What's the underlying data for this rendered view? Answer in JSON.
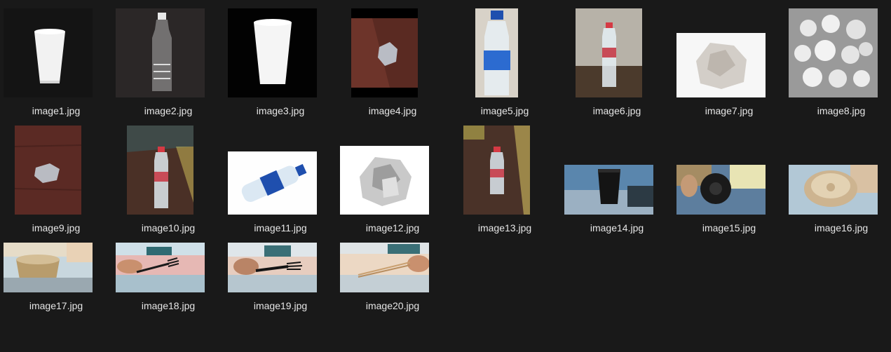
{
  "window": {
    "view": "Large icons",
    "background": "#191919",
    "label_color": "#e6e6e6"
  },
  "files": [
    {
      "name": "image1.jpg",
      "icon": "paper-cup-thumbnail"
    },
    {
      "name": "image2.jpg",
      "icon": "plastic-bottle-thumbnail"
    },
    {
      "name": "image3.jpg",
      "icon": "paper-cup-thumbnail"
    },
    {
      "name": "image4.jpg",
      "icon": "crumpled-paper-thumbnail"
    },
    {
      "name": "image5.jpg",
      "icon": "aquafina-bottle-thumbnail"
    },
    {
      "name": "image6.jpg",
      "icon": "water-bottle-thumbnail"
    },
    {
      "name": "image7.jpg",
      "icon": "crumpled-paper-thumbnail"
    },
    {
      "name": "image8.jpg",
      "icon": "paper-pile-thumbnail"
    },
    {
      "name": "image9.jpg",
      "icon": "crumpled-paper-thumbnail"
    },
    {
      "name": "image10.jpg",
      "icon": "water-bottle-thumbnail"
    },
    {
      "name": "image11.jpg",
      "icon": "aquafina-bottle-thumbnail"
    },
    {
      "name": "image12.jpg",
      "icon": "crumpled-paper-thumbnail"
    },
    {
      "name": "image13.jpg",
      "icon": "water-bottle-thumbnail"
    },
    {
      "name": "image14.jpg",
      "icon": "coffee-cup-thumbnail"
    },
    {
      "name": "image15.jpg",
      "icon": "cup-lid-thumbnail"
    },
    {
      "name": "image16.jpg",
      "icon": "paper-bowl-thumbnail"
    },
    {
      "name": "image17.jpg",
      "icon": "paper-bowl-thumbnail"
    },
    {
      "name": "image18.jpg",
      "icon": "plastic-fork-thumbnail"
    },
    {
      "name": "image19.jpg",
      "icon": "plastic-fork-thumbnail"
    },
    {
      "name": "image20.jpg",
      "icon": "chopsticks-thumbnail"
    }
  ]
}
